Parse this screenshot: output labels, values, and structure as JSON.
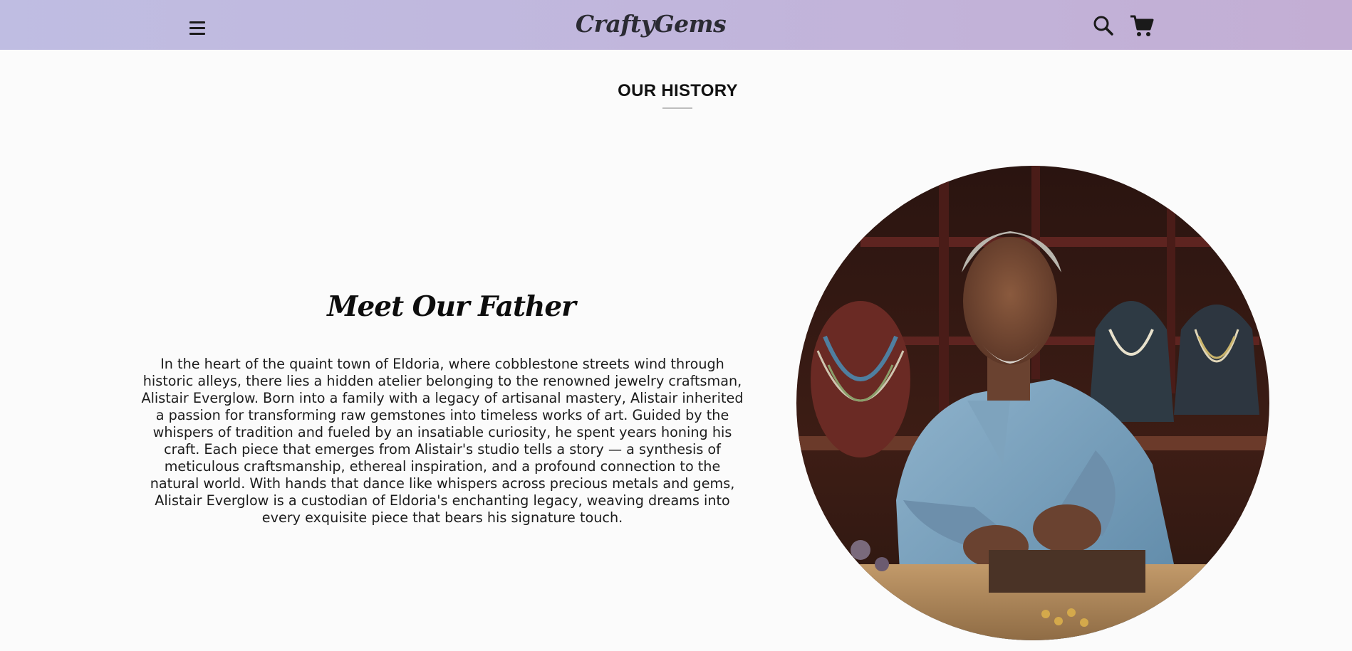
{
  "header": {
    "brand": "CraftyGems",
    "icons": [
      "menu-icon",
      "search-icon",
      "cart-icon"
    ]
  },
  "history": {
    "section_title": "OUR HISTORY",
    "heading": "Meet Our Father",
    "story": "In the heart of the quaint town of Eldoria, where cobblestone streets wind through historic alleys, there lies a hidden atelier belonging to the renowned jewelry craftsman, Alistair Everglow. Born into a family with a legacy of artisanal mastery, Alistair inherited a passion for transforming raw gemstones into timeless works of art. Guided by the whispers of tradition and fueled by an insatiable curiosity, he spent years honing his craft. Each piece that emerges from Alistair's studio tells a story — a synthesis of meticulous craftsmanship, ethereal inspiration, and a profound connection to the natural world. With hands that dance like whispers across precious metals and gems, Alistair Everglow is a custodian of Eldoria's enchanting legacy, weaving dreams into every exquisite piece that bears his signature touch."
  },
  "colors": {
    "nav_gradient_start": "#bfbde2",
    "nav_gradient_end": "#c3aed4",
    "page_background": "#fbfbfb",
    "text": "#111111"
  }
}
